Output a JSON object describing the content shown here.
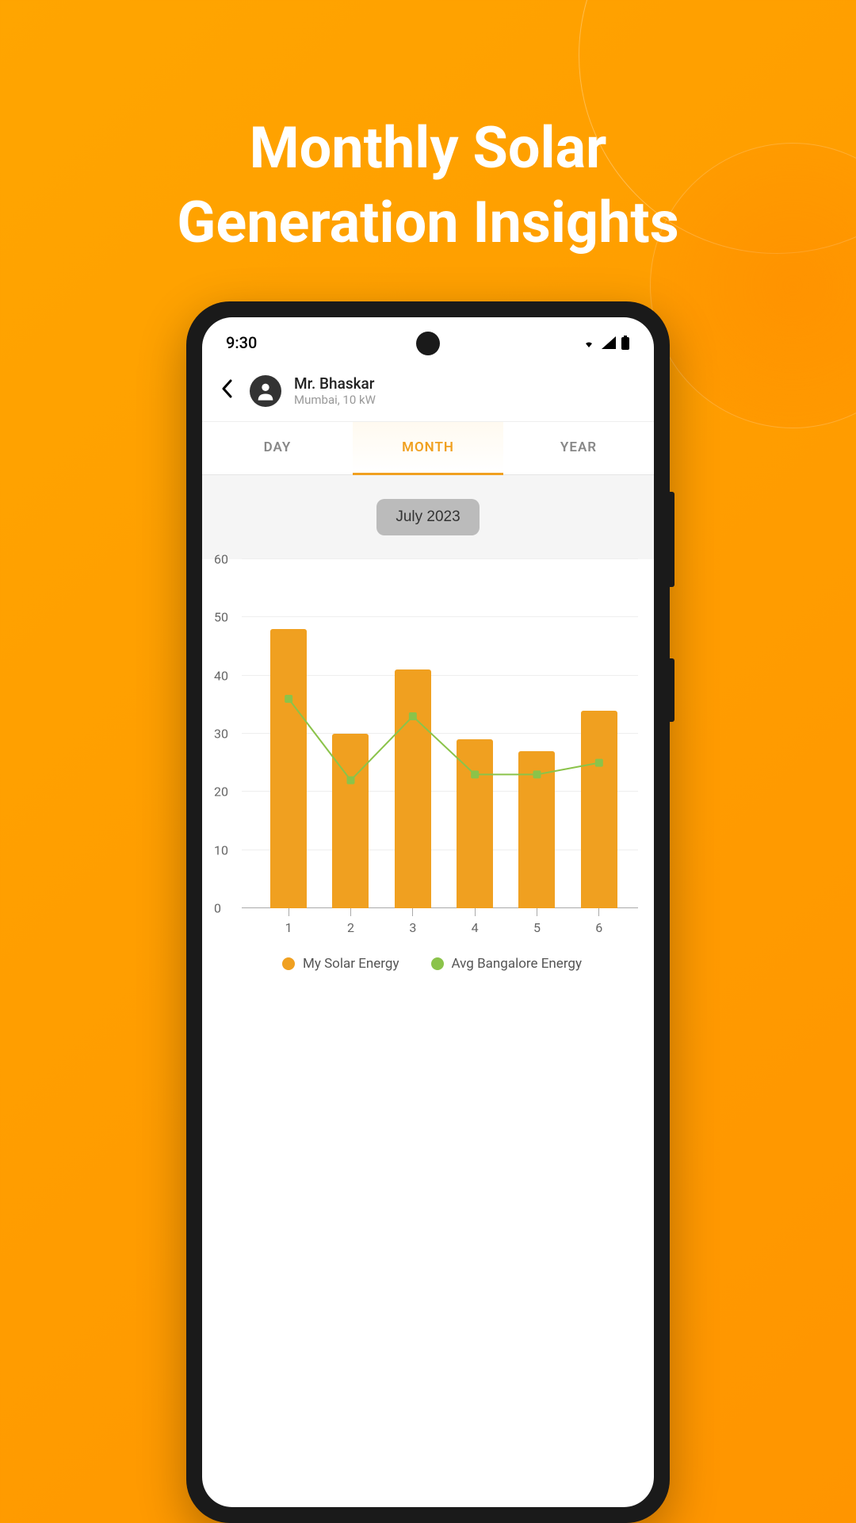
{
  "promo": {
    "headline_l1": "Monthly Solar",
    "headline_l2": "Generation Insights"
  },
  "status_bar": {
    "time": "9:30"
  },
  "header": {
    "user_name": "Mr. Bhaskar",
    "location": "Mumbai, 10 kW"
  },
  "tabs": {
    "items": [
      {
        "label": "DAY",
        "active": false
      },
      {
        "label": "MONTH",
        "active": true
      },
      {
        "label": "YEAR",
        "active": false
      }
    ]
  },
  "date_picker": {
    "label": "July 2023"
  },
  "legend": {
    "bar_label": "My Solar Energy",
    "line_label": "Avg Bangalore Energy"
  },
  "colors": {
    "bar": "#f0a020",
    "line": "#8bc34a"
  },
  "chart_data": {
    "type": "bar",
    "categories": [
      "1",
      "2",
      "3",
      "4",
      "5",
      "6"
    ],
    "series": [
      {
        "name": "My Solar Energy",
        "kind": "bar",
        "values": [
          48,
          30,
          41,
          29,
          27,
          34
        ]
      },
      {
        "name": "Avg Bangalore Energy",
        "kind": "line",
        "values": [
          36,
          22,
          33,
          23,
          23,
          25
        ]
      }
    ],
    "ylim": [
      0,
      60
    ],
    "yticks": [
      0,
      10,
      20,
      30,
      40,
      50,
      60
    ],
    "xlabel": "",
    "ylabel": "",
    "title": ""
  }
}
